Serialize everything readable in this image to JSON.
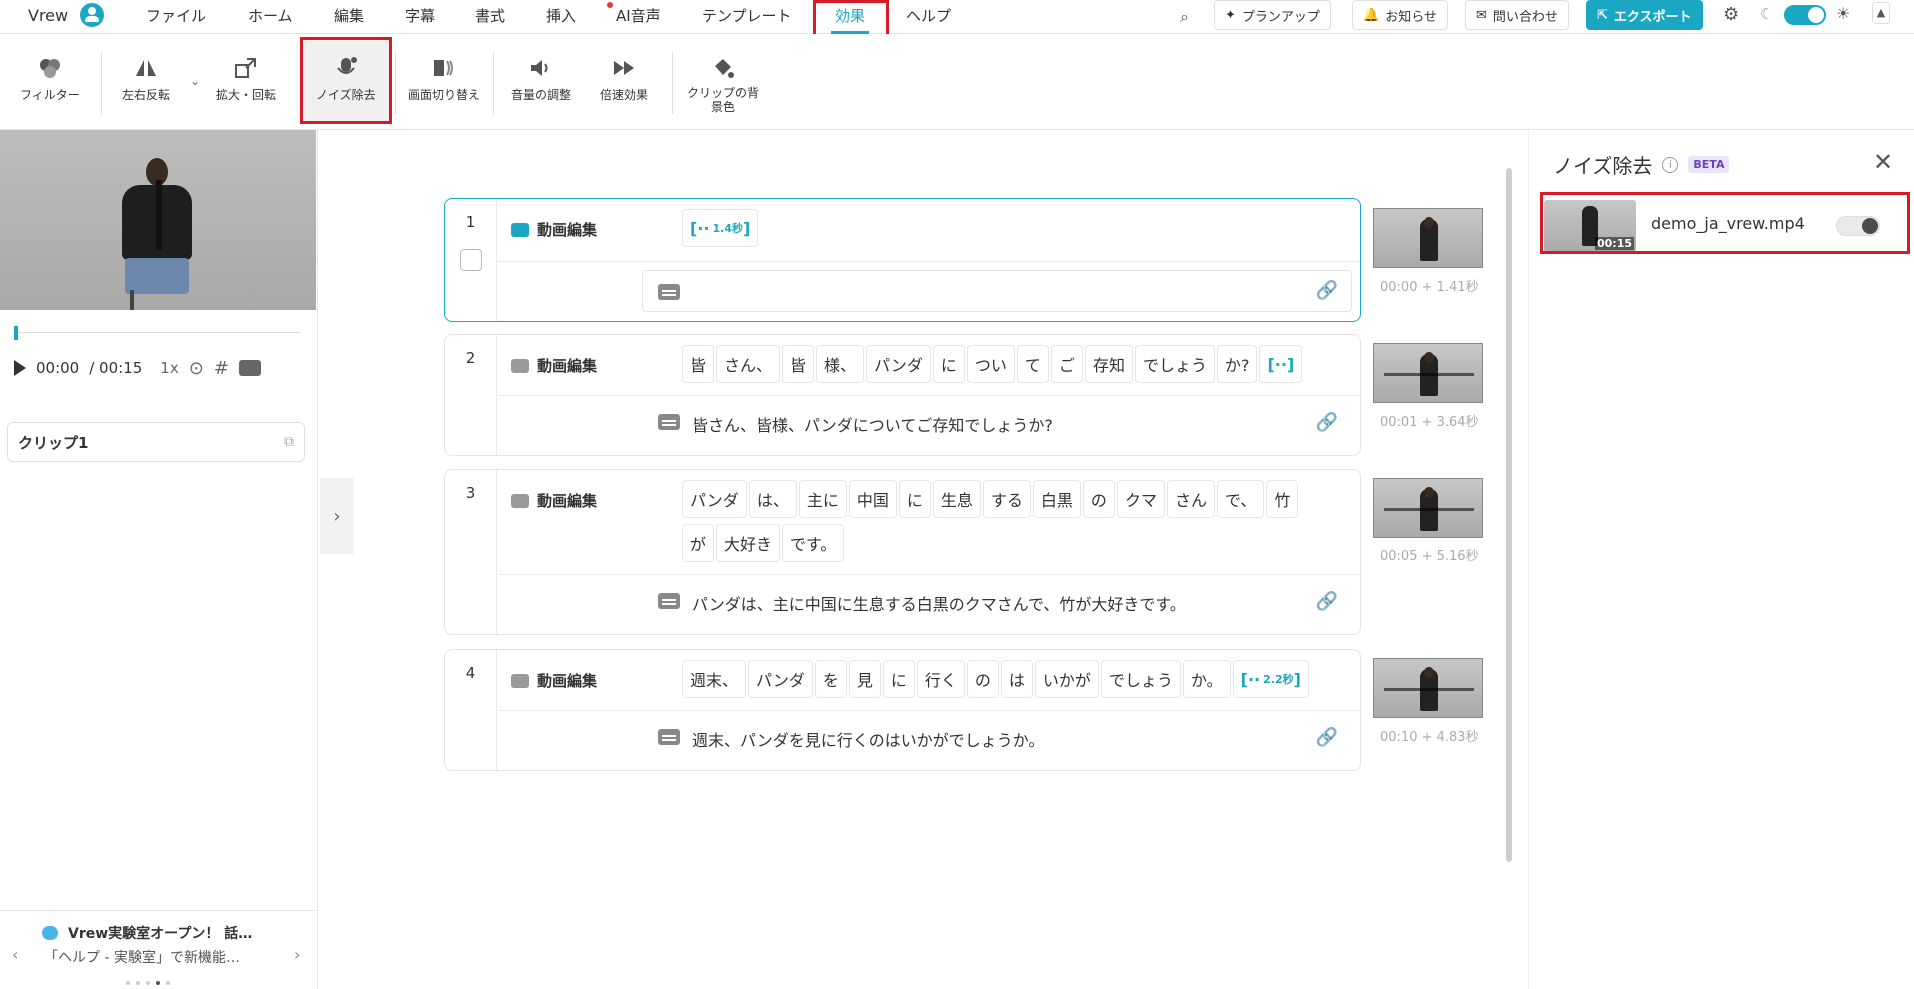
{
  "app": {
    "name": "Vrew"
  },
  "menu": [
    {
      "label": "ファイル"
    },
    {
      "label": "ホーム"
    },
    {
      "label": "編集"
    },
    {
      "label": "字幕"
    },
    {
      "label": "書式"
    },
    {
      "label": "挿入"
    },
    {
      "label": "AI音声"
    },
    {
      "label": "テンプレート"
    },
    {
      "label": "効果",
      "active": true
    },
    {
      "label": "ヘルプ"
    }
  ],
  "topbar": {
    "planup": "プランアップ",
    "notice": "お知らせ",
    "contact": "問い合わせ",
    "export": "エクスポート"
  },
  "ribbon": {
    "filter": "フィルター",
    "flip": "左右反転",
    "zoom": "拡大・回転",
    "noise": "ノイズ除去",
    "transition": "画面切り替え",
    "volume": "音量の調整",
    "speed": "倍速効果",
    "bgcolor": "クリップの背景色"
  },
  "player": {
    "current": "00:00",
    "total": "/ 00:15",
    "speed": "1x"
  },
  "clip_panel": {
    "title": "クリップ1"
  },
  "notice": {
    "title": "Vrew実験室オープン！ 話…",
    "body": "「ヘルプ - 実験室」で新機能…"
  },
  "clips": [
    {
      "num": "1",
      "label": "動画編集",
      "words": [
        {
          "text": "[·· ",
          "dur": "1.4秒",
          "silence": true
        }
      ],
      "subtitle": "",
      "time": "00:00 + 1.41秒"
    },
    {
      "num": "2",
      "label": "動画編集",
      "words": [
        {
          "text": "皆"
        },
        {
          "text": "さん、"
        },
        {
          "text": "皆"
        },
        {
          "text": "様、"
        },
        {
          "text": "パンダ"
        },
        {
          "text": "に"
        },
        {
          "text": "つい"
        },
        {
          "text": "て"
        },
        {
          "text": "ご"
        },
        {
          "text": "存知"
        },
        {
          "text": "でしょう"
        },
        {
          "text": "か?"
        },
        {
          "text": "[··]",
          "silence": true
        }
      ],
      "subtitle": "皆さん、皆様、パンダについてご存知でしょうか?",
      "time": "00:01 + 3.64秒"
    },
    {
      "num": "3",
      "label": "動画編集",
      "words": [
        {
          "text": "パンダ"
        },
        {
          "text": "は、"
        },
        {
          "text": "主に"
        },
        {
          "text": "中国"
        },
        {
          "text": "に"
        },
        {
          "text": "生息"
        },
        {
          "text": "する"
        },
        {
          "text": "白黒"
        },
        {
          "text": "の"
        },
        {
          "text": "クマ"
        },
        {
          "text": "さん"
        },
        {
          "text": "で、"
        },
        {
          "text": "竹"
        },
        {
          "text": "が"
        },
        {
          "text": "大好き"
        },
        {
          "text": "です。"
        }
      ],
      "subtitle": "パンダは、主に中国に生息する白黒のクマさんで、竹が大好きです。",
      "time": "00:05 + 5.16秒"
    },
    {
      "num": "4",
      "label": "動画編集",
      "words": [
        {
          "text": "週末、"
        },
        {
          "text": "パンダ"
        },
        {
          "text": "を"
        },
        {
          "text": "見"
        },
        {
          "text": "に"
        },
        {
          "text": "行く"
        },
        {
          "text": "の"
        },
        {
          "text": "は"
        },
        {
          "text": "いかが"
        },
        {
          "text": "でしょう"
        },
        {
          "text": "か。"
        },
        {
          "text": "[·· ",
          "dur": "2.2秒",
          "silence": true
        }
      ],
      "subtitle": "週末、パンダを見に行くのはいかがでしょうか。",
      "time": "00:10 + 4.83秒"
    }
  ],
  "noise_panel": {
    "title": "ノイズ除去",
    "badge": "BETA",
    "file_name": "demo_ja_vrew.mp4",
    "duration": "00:15",
    "enabled": false
  }
}
